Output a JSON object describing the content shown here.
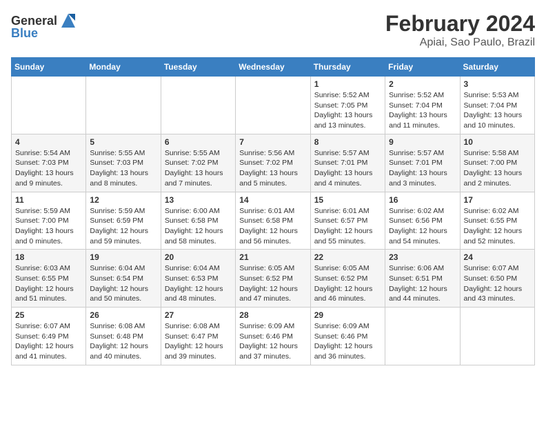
{
  "logo": {
    "text_general": "General",
    "text_blue": "Blue"
  },
  "title": "February 2024",
  "subtitle": "Apiai, Sao Paulo, Brazil",
  "days_of_week": [
    "Sunday",
    "Monday",
    "Tuesday",
    "Wednesday",
    "Thursday",
    "Friday",
    "Saturday"
  ],
  "weeks": [
    [
      {
        "day": "",
        "info": ""
      },
      {
        "day": "",
        "info": ""
      },
      {
        "day": "",
        "info": ""
      },
      {
        "day": "",
        "info": ""
      },
      {
        "day": "1",
        "info": "Sunrise: 5:52 AM\nSunset: 7:05 PM\nDaylight: 13 hours and 13 minutes."
      },
      {
        "day": "2",
        "info": "Sunrise: 5:52 AM\nSunset: 7:04 PM\nDaylight: 13 hours and 11 minutes."
      },
      {
        "day": "3",
        "info": "Sunrise: 5:53 AM\nSunset: 7:04 PM\nDaylight: 13 hours and 10 minutes."
      }
    ],
    [
      {
        "day": "4",
        "info": "Sunrise: 5:54 AM\nSunset: 7:03 PM\nDaylight: 13 hours and 9 minutes."
      },
      {
        "day": "5",
        "info": "Sunrise: 5:55 AM\nSunset: 7:03 PM\nDaylight: 13 hours and 8 minutes."
      },
      {
        "day": "6",
        "info": "Sunrise: 5:55 AM\nSunset: 7:02 PM\nDaylight: 13 hours and 7 minutes."
      },
      {
        "day": "7",
        "info": "Sunrise: 5:56 AM\nSunset: 7:02 PM\nDaylight: 13 hours and 5 minutes."
      },
      {
        "day": "8",
        "info": "Sunrise: 5:57 AM\nSunset: 7:01 PM\nDaylight: 13 hours and 4 minutes."
      },
      {
        "day": "9",
        "info": "Sunrise: 5:57 AM\nSunset: 7:01 PM\nDaylight: 13 hours and 3 minutes."
      },
      {
        "day": "10",
        "info": "Sunrise: 5:58 AM\nSunset: 7:00 PM\nDaylight: 13 hours and 2 minutes."
      }
    ],
    [
      {
        "day": "11",
        "info": "Sunrise: 5:59 AM\nSunset: 7:00 PM\nDaylight: 13 hours and 0 minutes."
      },
      {
        "day": "12",
        "info": "Sunrise: 5:59 AM\nSunset: 6:59 PM\nDaylight: 12 hours and 59 minutes."
      },
      {
        "day": "13",
        "info": "Sunrise: 6:00 AM\nSunset: 6:58 PM\nDaylight: 12 hours and 58 minutes."
      },
      {
        "day": "14",
        "info": "Sunrise: 6:01 AM\nSunset: 6:58 PM\nDaylight: 12 hours and 56 minutes."
      },
      {
        "day": "15",
        "info": "Sunrise: 6:01 AM\nSunset: 6:57 PM\nDaylight: 12 hours and 55 minutes."
      },
      {
        "day": "16",
        "info": "Sunrise: 6:02 AM\nSunset: 6:56 PM\nDaylight: 12 hours and 54 minutes."
      },
      {
        "day": "17",
        "info": "Sunrise: 6:02 AM\nSunset: 6:55 PM\nDaylight: 12 hours and 52 minutes."
      }
    ],
    [
      {
        "day": "18",
        "info": "Sunrise: 6:03 AM\nSunset: 6:55 PM\nDaylight: 12 hours and 51 minutes."
      },
      {
        "day": "19",
        "info": "Sunrise: 6:04 AM\nSunset: 6:54 PM\nDaylight: 12 hours and 50 minutes."
      },
      {
        "day": "20",
        "info": "Sunrise: 6:04 AM\nSunset: 6:53 PM\nDaylight: 12 hours and 48 minutes."
      },
      {
        "day": "21",
        "info": "Sunrise: 6:05 AM\nSunset: 6:52 PM\nDaylight: 12 hours and 47 minutes."
      },
      {
        "day": "22",
        "info": "Sunrise: 6:05 AM\nSunset: 6:52 PM\nDaylight: 12 hours and 46 minutes."
      },
      {
        "day": "23",
        "info": "Sunrise: 6:06 AM\nSunset: 6:51 PM\nDaylight: 12 hours and 44 minutes."
      },
      {
        "day": "24",
        "info": "Sunrise: 6:07 AM\nSunset: 6:50 PM\nDaylight: 12 hours and 43 minutes."
      }
    ],
    [
      {
        "day": "25",
        "info": "Sunrise: 6:07 AM\nSunset: 6:49 PM\nDaylight: 12 hours and 41 minutes."
      },
      {
        "day": "26",
        "info": "Sunrise: 6:08 AM\nSunset: 6:48 PM\nDaylight: 12 hours and 40 minutes."
      },
      {
        "day": "27",
        "info": "Sunrise: 6:08 AM\nSunset: 6:47 PM\nDaylight: 12 hours and 39 minutes."
      },
      {
        "day": "28",
        "info": "Sunrise: 6:09 AM\nSunset: 6:46 PM\nDaylight: 12 hours and 37 minutes."
      },
      {
        "day": "29",
        "info": "Sunrise: 6:09 AM\nSunset: 6:46 PM\nDaylight: 12 hours and 36 minutes."
      },
      {
        "day": "",
        "info": ""
      },
      {
        "day": "",
        "info": ""
      }
    ]
  ]
}
